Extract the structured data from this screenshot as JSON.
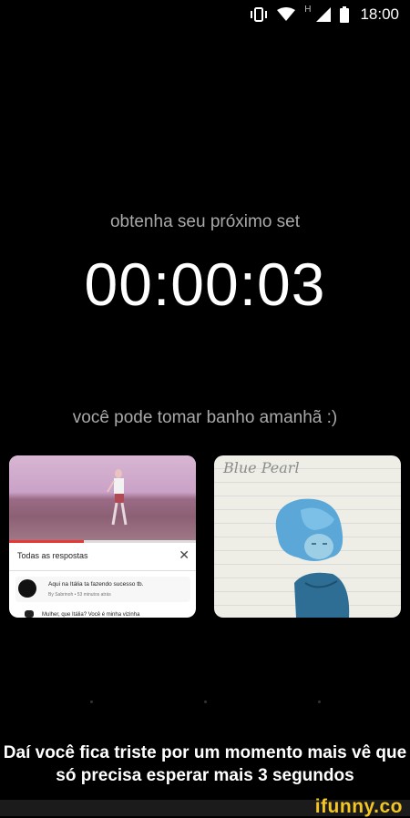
{
  "status_bar": {
    "time": "18:00",
    "network_label": "H",
    "icons": [
      "vibrate-icon",
      "wifi-icon",
      "signal-icon",
      "battery-icon"
    ]
  },
  "timer_screen": {
    "prompt": "obtenha seu próximo set",
    "countdown": "00:00:03",
    "subtitle": "você pode tomar banho amanhã :)"
  },
  "left_card": {
    "comments_title": "Todas as respostas",
    "comment_text": "Aqui na Itália ta fazendo sucesso tb.",
    "comment_meta": "By Sabrinoh • 53 minutos atrás",
    "second_comment": "Mulher, que Itália? Você é minha vizinha",
    "progress": 0.4
  },
  "right_card": {
    "drawing_text": "Blue Pearl"
  },
  "caption": "Daí você fica triste por um momento mais vê que só precisa esperar mais 3 segundos",
  "watermark": "ifunny.co",
  "colors": {
    "background": "#000000",
    "muted_text": "#a9a9a9",
    "watermark": "#f3c623"
  }
}
